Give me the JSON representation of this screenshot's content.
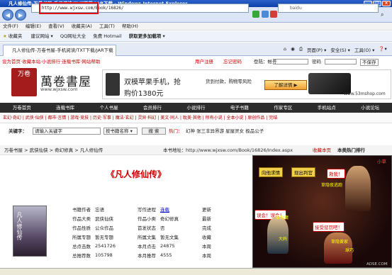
{
  "window": {
    "title": "凡人修仙传-万卷书屋-手机阅读/TXT下载/JAR下载 - Windows Internet Explorer"
  },
  "address": {
    "url_prefix": "http://www.wjxsw.com/",
    "url_rest": "Book/16826/",
    "search_placeholder": "baidu"
  },
  "menu": {
    "items": [
      "文件(F)",
      "编辑(E)",
      "查看(V)",
      "收藏夹(A)",
      "工具(T)",
      "帮助(H)"
    ]
  },
  "favbar": {
    "favorites": "收藏夹",
    "items": [
      "建议网站 ▾",
      "QQ网址大全",
      "免费 Hotmail",
      "获取更多加载项 ▾"
    ]
  },
  "tab": {
    "label": "凡人修仙传-万卷书屋-手机阅读/TXT下载/JAR下载",
    "right_tools": [
      "页面(P) ▾",
      "安全(S) ▾",
      "工具(O) ▾",
      "❓▾"
    ]
  },
  "site": {
    "top_left": "设为首页·收藏本站·小说排行·连载书库·网站帮助",
    "top_right_links": [
      "用户注册",
      "忘记密码"
    ],
    "login_label": "登陆：帐号",
    "password_label": "密码",
    "save_label": "不保存",
    "logo_text": "萬卷書屋",
    "logo_badge": "万卷",
    "logo_url": "www.wjxsw.com",
    "ad_text1": "双模苹果手机，抢",
    "ad_text2": "购价1380元",
    "ad_text3": "货到付款，购物零风险",
    "ad_button": "了解详情 ▶",
    "ad_url": "www.53mshop.com"
  },
  "nav": {
    "items": [
      "万卷首页",
      "连载书库",
      "个人书屋",
      "会员排行",
      "小说排行",
      "电子书籍",
      "作家专区",
      "手机站点",
      "小说论坛"
    ]
  },
  "subnav": {
    "text": "玄幻·奇幻 | 武侠·仙侠 | 都市·言情 | 游戏·竞技 | 历史·军事 | 魔法·玄幻 | 灵异·科幻 | 美文·同人 | 耽美·其他 | 所有小说 | 全本小说 | 原创作品 | 完结"
  },
  "search": {
    "keyword_label": "关键字：",
    "input_value": "请输入关键字",
    "select_value": "按书籍名称 ▾",
    "button": "搜 索",
    "hot_label": "热门：",
    "hot_items": "幻神 张三丰异界游 星屋灵女 极品公子"
  },
  "crumb": {
    "text": "万卷书屋 > 武侠仙侠 > 奇幻修真 > 凡人修仙传",
    "address_label": "本书地址：",
    "address_url": "http://www.wjxsw.com/Book/16826/Index.aspx",
    "favorite": "收藏本页",
    "hot_rank": "本类热门排行"
  },
  "book": {
    "title": "《凡人修仙传》",
    "rows": [
      [
        "书籍作者",
        "忘语",
        "写作进程",
        "连载",
        "更新"
      ],
      [
        "作品大类",
        "武侠仙侠",
        "作品小类",
        "奇幻修真",
        "最新"
      ],
      [
        "作品性质",
        "公众作品",
        "首发状态",
        "否",
        "完成"
      ],
      [
        "所属专题",
        "暂无专题",
        "所属文集",
        "暂无文集",
        "收藏"
      ],
      [
        "总点击数",
        "2541726",
        "本月点击",
        "24875",
        "本周"
      ],
      [
        "总推荐数",
        "105798",
        "本月推荐",
        "4555",
        "本周"
      ]
    ]
  },
  "game_ad": {
    "buttons": [
      "向他求情",
      "现出判官"
    ],
    "bubbles": [
      "救我！",
      "误会！误会！",
      "接受惩罚吧！"
    ],
    "labels": [
      "小草",
      "草隐夜逃跑",
      "接受惩罚吧！",
      "草隐魔",
      "草隐黄家",
      "球巧",
      "大妈"
    ],
    "footer": "ADSE.COM"
  },
  "colors": {
    "title_blue": "#0a3fa8",
    "accent_red": "#c00000",
    "nav_dark": "#2c2c2c"
  }
}
